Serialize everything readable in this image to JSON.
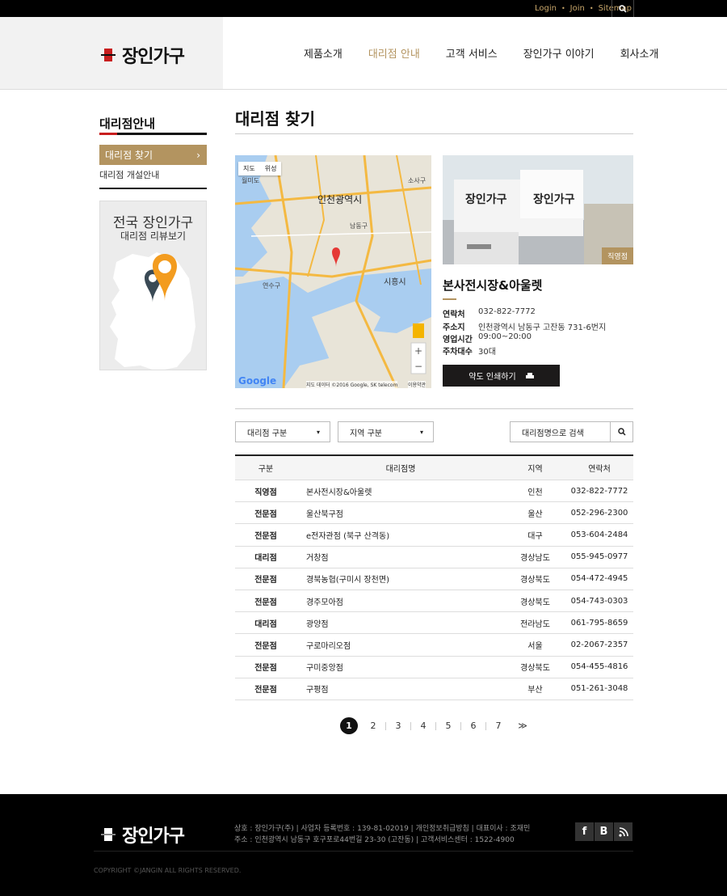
{
  "topbar": {
    "login": "Login",
    "join": "Join",
    "sitemap": "Sitemap"
  },
  "brand": {
    "name": "장인가구"
  },
  "nav": [
    "제품소개",
    "대리점 안내",
    "고객 서비스",
    "장인가구 이야기",
    "회사소개"
  ],
  "nav_active_index": 1,
  "sidebar": {
    "title": "대리점안내",
    "items": [
      "대리점 찾기",
      "대리점 개설안내"
    ],
    "banner": {
      "line1": "전국 장인가구",
      "line2": "대리점 리뷰보기"
    }
  },
  "page": {
    "title": "대리점 찾기"
  },
  "map": {
    "tab_map": "지도",
    "tab_sat": "위성",
    "labels": [
      "인천광역시",
      "시흥시",
      "월미도",
      "소사구",
      "연수구",
      "남동구"
    ],
    "attribution": "지도 데이터 ©2016 Google, SK telecom",
    "terms": "이용약관",
    "google": "Google"
  },
  "store": {
    "photo_tag": "직영점",
    "name": "본사전시장&아울렛",
    "fields": [
      {
        "k": "연락처",
        "v": "032-822-7772"
      },
      {
        "k": "주소지",
        "v": "인천광역시 남동구 고잔동 731-6번지"
      },
      {
        "k": "영업시간",
        "v": "09:00~20:00"
      },
      {
        "k": "주차대수",
        "v": "30대"
      }
    ],
    "print_label": "약도 인쇄하기",
    "sign": "장인가구"
  },
  "filters": {
    "type_label": "대리점 구분",
    "region_label": "지역 구분",
    "search_placeholder": "대리점명으로 검색"
  },
  "table": {
    "headers": [
      "구분",
      "대리점명",
      "지역",
      "연락처"
    ],
    "rows": [
      [
        "직영점",
        "본사전시장&아울렛",
        "인천",
        "032-822-7772"
      ],
      [
        "전문점",
        "울산북구점",
        "울산",
        "052-296-2300"
      ],
      [
        "전문점",
        "e전자관점 (북구 산격동)",
        "대구",
        "053-604-2484"
      ],
      [
        "대리점",
        "거창점",
        "경상남도",
        "055-945-0977"
      ],
      [
        "전문점",
        "경북농협(구미시 장천면)",
        "경상북도",
        "054-472-4945"
      ],
      [
        "전문점",
        "경주모아점",
        "경상북도",
        "054-743-0303"
      ],
      [
        "대리점",
        "광양점",
        "전라남도",
        "061-795-8659"
      ],
      [
        "전문점",
        "구로마리오점",
        "서울",
        "02-2067-2357"
      ],
      [
        "전문점",
        "구미중앙점",
        "경상북도",
        "054-455-4816"
      ],
      [
        "전문점",
        "구평점",
        "부산",
        "051-261-3048"
      ]
    ]
  },
  "pagination": {
    "pages": [
      "1",
      "2",
      "3",
      "4",
      "5",
      "6",
      "7"
    ],
    "current": "1",
    "next": "≫"
  },
  "footer": {
    "line1": "상호 : 장인가구(주)  |  사업자 등록번호 : 139-81-02019  |  개인정보취급방침  |  대표이사 : 조재민",
    "line2": "주소 : 인천광역시 남동구 호구포로44번길 23-30 (고잔동)  |  고객서비스센터 : 1522-4900",
    "copyright": "COPYRIGHT ©JANGIN ALL RIGHTS RESERVED.",
    "sns": [
      "f",
      "B",
      "rss-icon"
    ]
  },
  "colors": {
    "accent": "#b39460",
    "brand_red": "#c81e1e",
    "dark": "#1c1a1a"
  }
}
